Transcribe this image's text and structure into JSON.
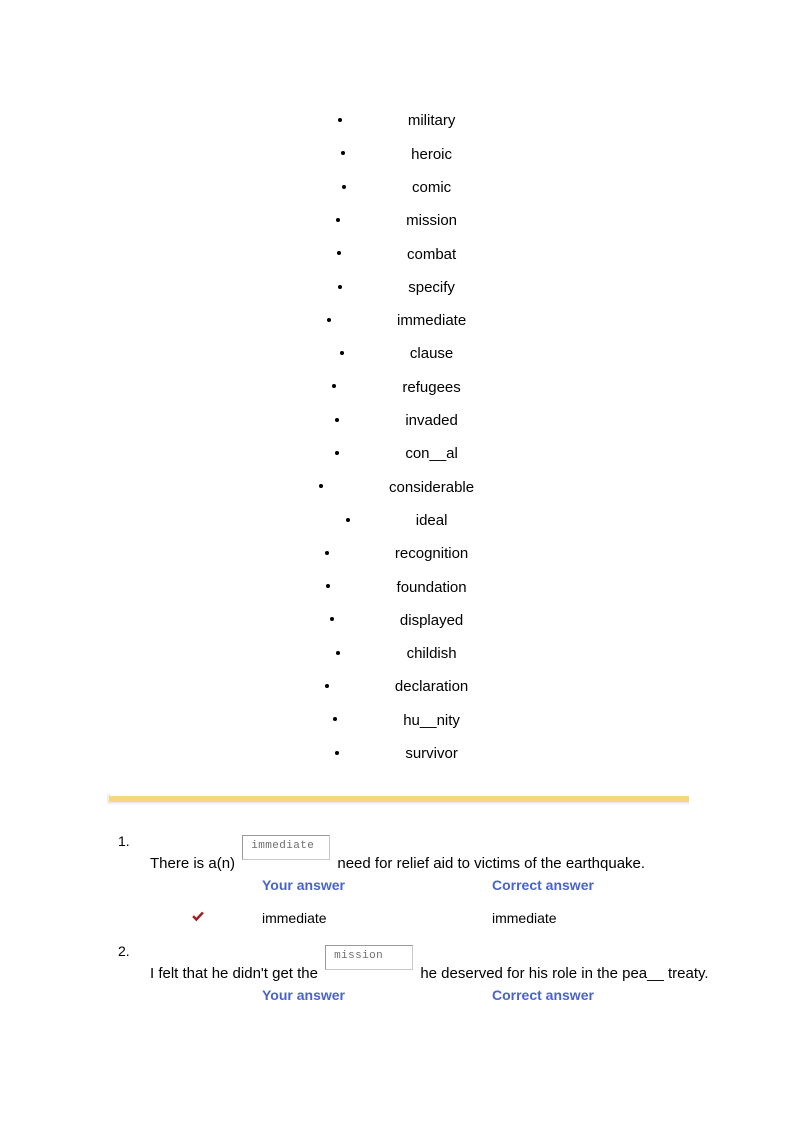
{
  "vocab_list": {
    "items": [
      "military",
      "heroic",
      "comic",
      "mission",
      "combat",
      "specify",
      "immediate",
      "clause",
      "refugees",
      "invaded",
      "con__al",
      "considerable",
      "ideal",
      "recognition",
      "foundation",
      "displayed",
      "childish",
      "declaration",
      "hu__nity",
      "survivor"
    ]
  },
  "divider": {
    "color": "#f5d87d"
  },
  "colors": {
    "header_blue": "#4a63c8",
    "check_red": "#a61c1c",
    "divider_yellow": "#f5d87d",
    "input_text_grey": "#6e6e6e"
  },
  "questions": [
    {
      "number": "1.",
      "text_before": "There is a(n)",
      "answer_value": "immediate",
      "text_after": "need for relief aid to victims of the earthquake.",
      "your_answer_label": "Your answer",
      "correct_answer_label": "Correct answer",
      "your_answer": "immediate",
      "correct_answer": "immediate",
      "is_correct": true,
      "check_icon": "check-icon"
    },
    {
      "number": "2.",
      "text_before": "I felt that he didn't get the",
      "answer_value": "mission",
      "text_after": "he deserved for his role in the pea__ treaty.",
      "your_answer_label": "Your answer",
      "correct_answer_label": "Correct answer",
      "your_answer": "",
      "correct_answer": "",
      "is_correct": false,
      "check_icon": ""
    }
  ]
}
